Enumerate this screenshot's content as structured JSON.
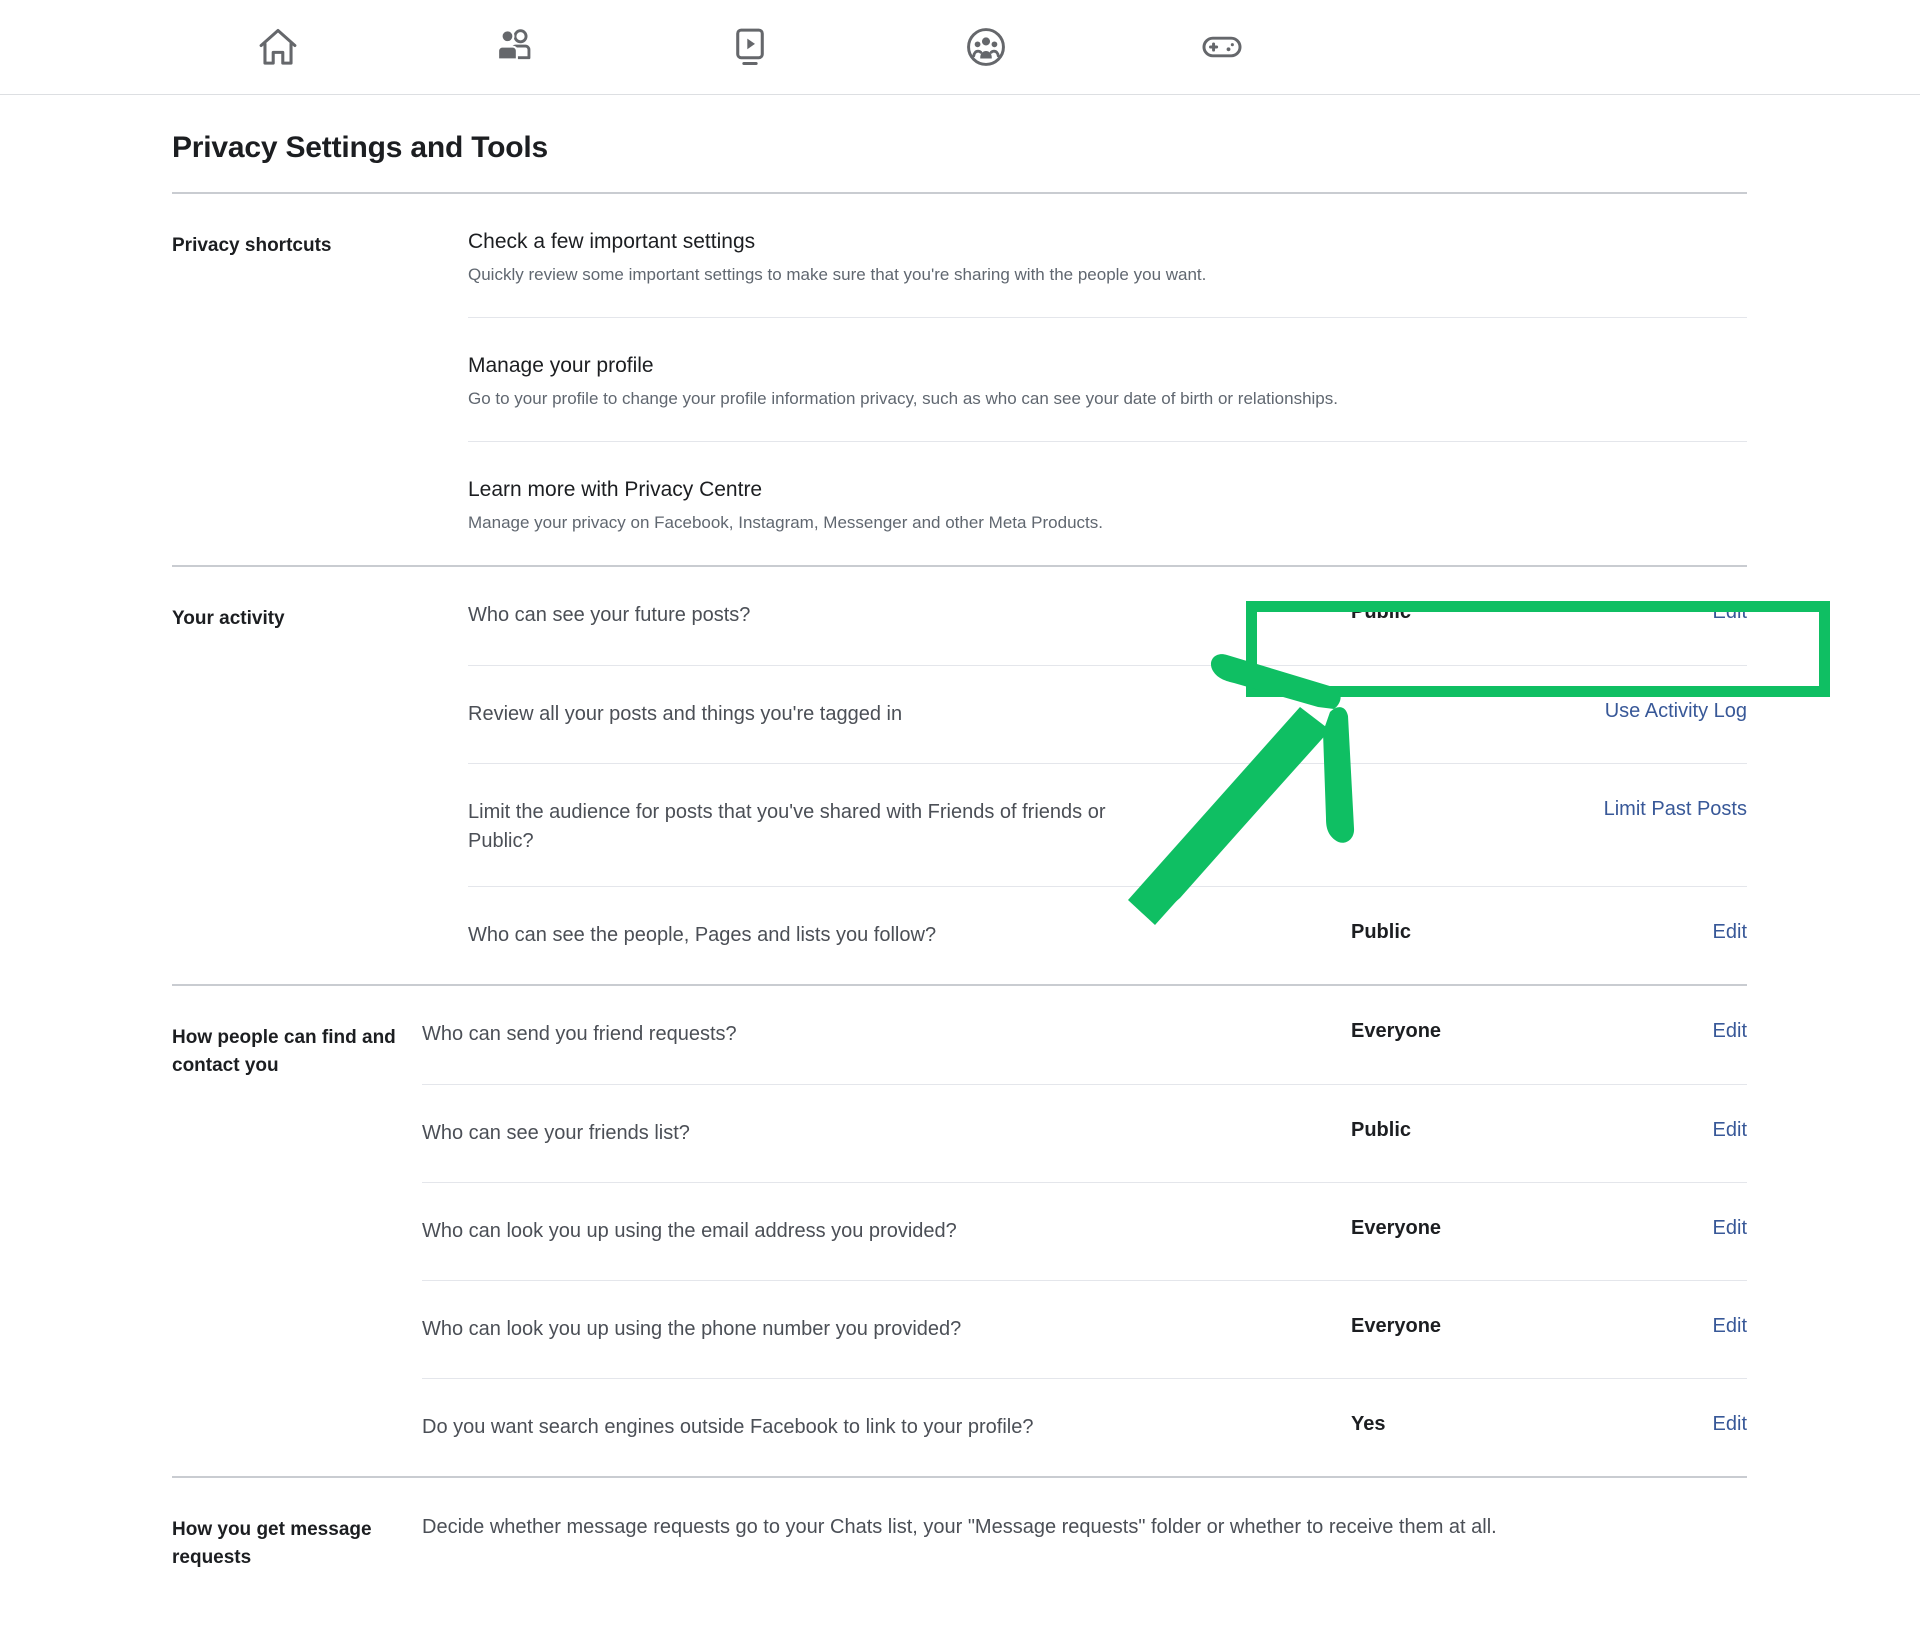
{
  "nav": {
    "items": [
      {
        "icon": "home-icon",
        "label": "Home"
      },
      {
        "icon": "friends-icon",
        "label": "Friends"
      },
      {
        "icon": "video-icon",
        "label": "Video"
      },
      {
        "icon": "groups-icon",
        "label": "Groups"
      },
      {
        "icon": "gaming-icon",
        "label": "Gaming"
      }
    ]
  },
  "page": {
    "title": "Privacy Settings and Tools"
  },
  "sections": [
    {
      "label": "Privacy shortcuts",
      "rows": [
        {
          "heading": "Check a few important settings",
          "desc": "Quickly review some important settings to make sure that you're sharing with the people you want."
        },
        {
          "heading": "Manage your profile",
          "desc": "Go to your profile to change your profile information privacy, such as who can see your date of birth or relationships."
        },
        {
          "heading": "Learn more with Privacy Centre",
          "desc": "Manage your privacy on Facebook, Instagram, Messenger and other Meta Products."
        }
      ]
    },
    {
      "label": "Your activity",
      "rows": [
        {
          "question": "Who can see your future posts?",
          "value": "Public",
          "action": "Edit"
        },
        {
          "question": "Review all your posts and things you're tagged in",
          "value": "",
          "action": "Use Activity Log"
        },
        {
          "question": "Limit the audience for posts that you've shared with Friends of friends or Public?",
          "value": "",
          "action": "Limit Past Posts"
        },
        {
          "question": "Who can see the people, Pages and lists you follow?",
          "value": "Public",
          "action": "Edit"
        }
      ]
    },
    {
      "label": "How people can find and contact you",
      "rows": [
        {
          "question": "Who can send you friend requests?",
          "value": "Everyone",
          "action": "Edit"
        },
        {
          "question": "Who can see your friends list?",
          "value": "Public",
          "action": "Edit"
        },
        {
          "question": "Who can look you up using the email address you provided?",
          "value": "Everyone",
          "action": "Edit"
        },
        {
          "question": "Who can look you up using the phone number you provided?",
          "value": "Everyone",
          "action": "Edit"
        },
        {
          "question": "Do you want search engines outside Facebook to link to your profile?",
          "value": "Yes",
          "action": "Edit"
        }
      ]
    },
    {
      "label": "How you get message requests",
      "text": "Decide whether message requests go to your Chats list, your \"Message requests\" folder or whether to receive them at all."
    }
  ],
  "annotation": {
    "highlight_color": "#0fbf63",
    "arrow_color": "#0fbf63",
    "highlighted_target": "Public / Edit for \"Who can see your future posts?\""
  }
}
